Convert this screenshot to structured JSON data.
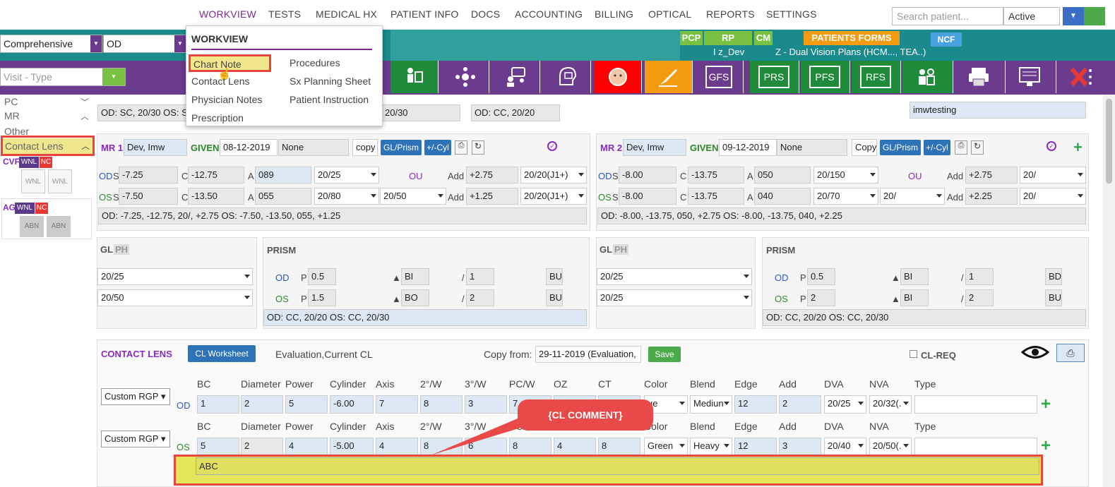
{
  "topnav": {
    "items": [
      "WORKVIEW",
      "TESTS",
      "MEDICAL HX",
      "PATIENT INFO",
      "DOCS",
      "ACCOUNTING",
      "BILLING",
      "OPTICAL",
      "REPORTS",
      "SETTINGS"
    ],
    "search_placeholder": "Search patient...",
    "status": "Active"
  },
  "header": {
    "exam_type": "Comprehensive",
    "eye": "OD",
    "visit_type_placeholder": "Visit - Type",
    "tags": {
      "pcp": "PCP",
      "rp": "RP",
      "cm": "CM",
      "patients_forms": "PATIENTS FORMS",
      "ncf": "NCF"
    },
    "provider": "I z_Dev",
    "insurance": "Z - Dual Vision Plans (HCM..., TEA..)"
  },
  "toolbar": {
    "gfs": "GFS",
    "prs": "PRS",
    "pfs": "PFS",
    "rfs": "RFS"
  },
  "menu": {
    "title": "WORKVIEW",
    "col1": [
      "Chart Note",
      "Contact Lens",
      "Physician Notes",
      "Prescription"
    ],
    "col2": [
      "Procedures",
      "Sx Planning Sheet",
      "Patient Instruction"
    ]
  },
  "left": {
    "items": [
      "PC",
      "MR",
      "Other",
      "Contact Lens"
    ],
    "cvf": "CVF",
    "ag": "AG",
    "wnl": "WNL",
    "nc": "NC",
    "abn": "ABN"
  },
  "top_summary": {
    "left": "OD: SC, 20/30 OS: SC",
    "mid": "20/30",
    "right": "OD: CC, 20/20",
    "far": "imwtesting"
  },
  "mr1": {
    "label": "MR 1",
    "provider": "Dev, Imw",
    "given": "GIVEN",
    "date": "08-12-2019",
    "type": "None",
    "copy": "copy",
    "gl_prism": "GL/Prism",
    "cyl": "+/-Cyl",
    "od": {
      "s": "-7.25",
      "c": "-12.75",
      "a": "089",
      "va": "20/25",
      "add": "+2.75",
      "near": "20/20(J1+)"
    },
    "os": {
      "s": "-7.50",
      "c": "-13.50",
      "a": "055",
      "va": "20/80",
      "va2": "20/50",
      "add": "+1.25",
      "near": "20/20(J1+)"
    },
    "summary": "OD: -7.25, -12.75, 20/, +2.75 OS: -7.50, -13.50, 055, +1.25"
  },
  "mr2": {
    "label": "MR 2",
    "provider": "Dev, Imw",
    "given": "GIVEN",
    "date": "09-12-2019",
    "type": "None",
    "copy": "Copy",
    "gl_prism": "GL/Prism",
    "cyl": "+/-Cyl",
    "od": {
      "s": "-8.00",
      "c": "-13.75",
      "a": "050",
      "va": "20/150",
      "add": "+2.75",
      "near": "20/"
    },
    "os": {
      "s": "-8.00",
      "c": "-13.75",
      "a": "040",
      "va": "20/70",
      "va2": "20/",
      "add": "+2.25",
      "near": "20/"
    },
    "summary": "OD: -8.00, -13.75, 050, +2.75 OS: -8.00, -13.75, 040, +2.25"
  },
  "gl1": {
    "gl": "GL",
    "ph": "PH",
    "od": "20/25",
    "os": "20/50"
  },
  "gl2": {
    "gl": "GL",
    "ph": "PH",
    "od": "20/25",
    "os": "20/25"
  },
  "prism1": {
    "title": "PRISM",
    "od": {
      "p": "0.5",
      "b1": "BI",
      "v2": "1",
      "b2": "BU"
    },
    "os": {
      "p": "1.5",
      "b1": "BO",
      "v2": "2",
      "b2": "BU"
    },
    "summary": "OD: CC, 20/20 OS: CC, 20/30"
  },
  "prism2": {
    "title": "PRISM",
    "od": {
      "p": "0.5",
      "b1": "BI",
      "v2": "1",
      "b2": "BD"
    },
    "os": {
      "p": "2",
      "b1": "BI",
      "v2": "2",
      "b2": "BU"
    },
    "summary": "OD: CC, 20/20 OS: CC, 20/30"
  },
  "labels": {
    "od": "OD",
    "os": "OS",
    "ou": "OU",
    "s": "S",
    "c": "C",
    "a": "A",
    "add": "Add",
    "p": "P",
    "slash": "/"
  },
  "cl": {
    "title": "CONTACT LENS",
    "worksheet": "CL Worksheet",
    "evaluation": "Evaluation,Current CL",
    "copy_from": "Copy from:",
    "copy_value": "29-11-2019 (Evaluation,",
    "save": "Save",
    "clreq": "CL-REQ",
    "headers": [
      "BC",
      "Diameter",
      "Power",
      "Cylinder",
      "Axis",
      "2°/W",
      "3°/W",
      "PC/W",
      "OZ",
      "CT",
      "Color",
      "Blend",
      "Edge",
      "Add",
      "DVA",
      "NVA",
      "Type"
    ],
    "od": {
      "lens": "Custom RGP",
      "values": [
        "1",
        "2",
        "5",
        "-6.00",
        "7",
        "8",
        "3",
        "7",
        "",
        "",
        "ue",
        "Mediun",
        "12",
        "2",
        "20/25",
        "20/32(."
      ]
    },
    "os": {
      "lens": "Custom RGP",
      "values": [
        "5",
        "2",
        "4",
        "-5.00",
        "4",
        "8",
        "6",
        "8",
        "4",
        "8",
        "Green",
        "Heavy",
        "12",
        "3",
        "20/40",
        "20/50(."
      ]
    },
    "comment": "ABC",
    "callout": "{CL COMMENT}"
  }
}
